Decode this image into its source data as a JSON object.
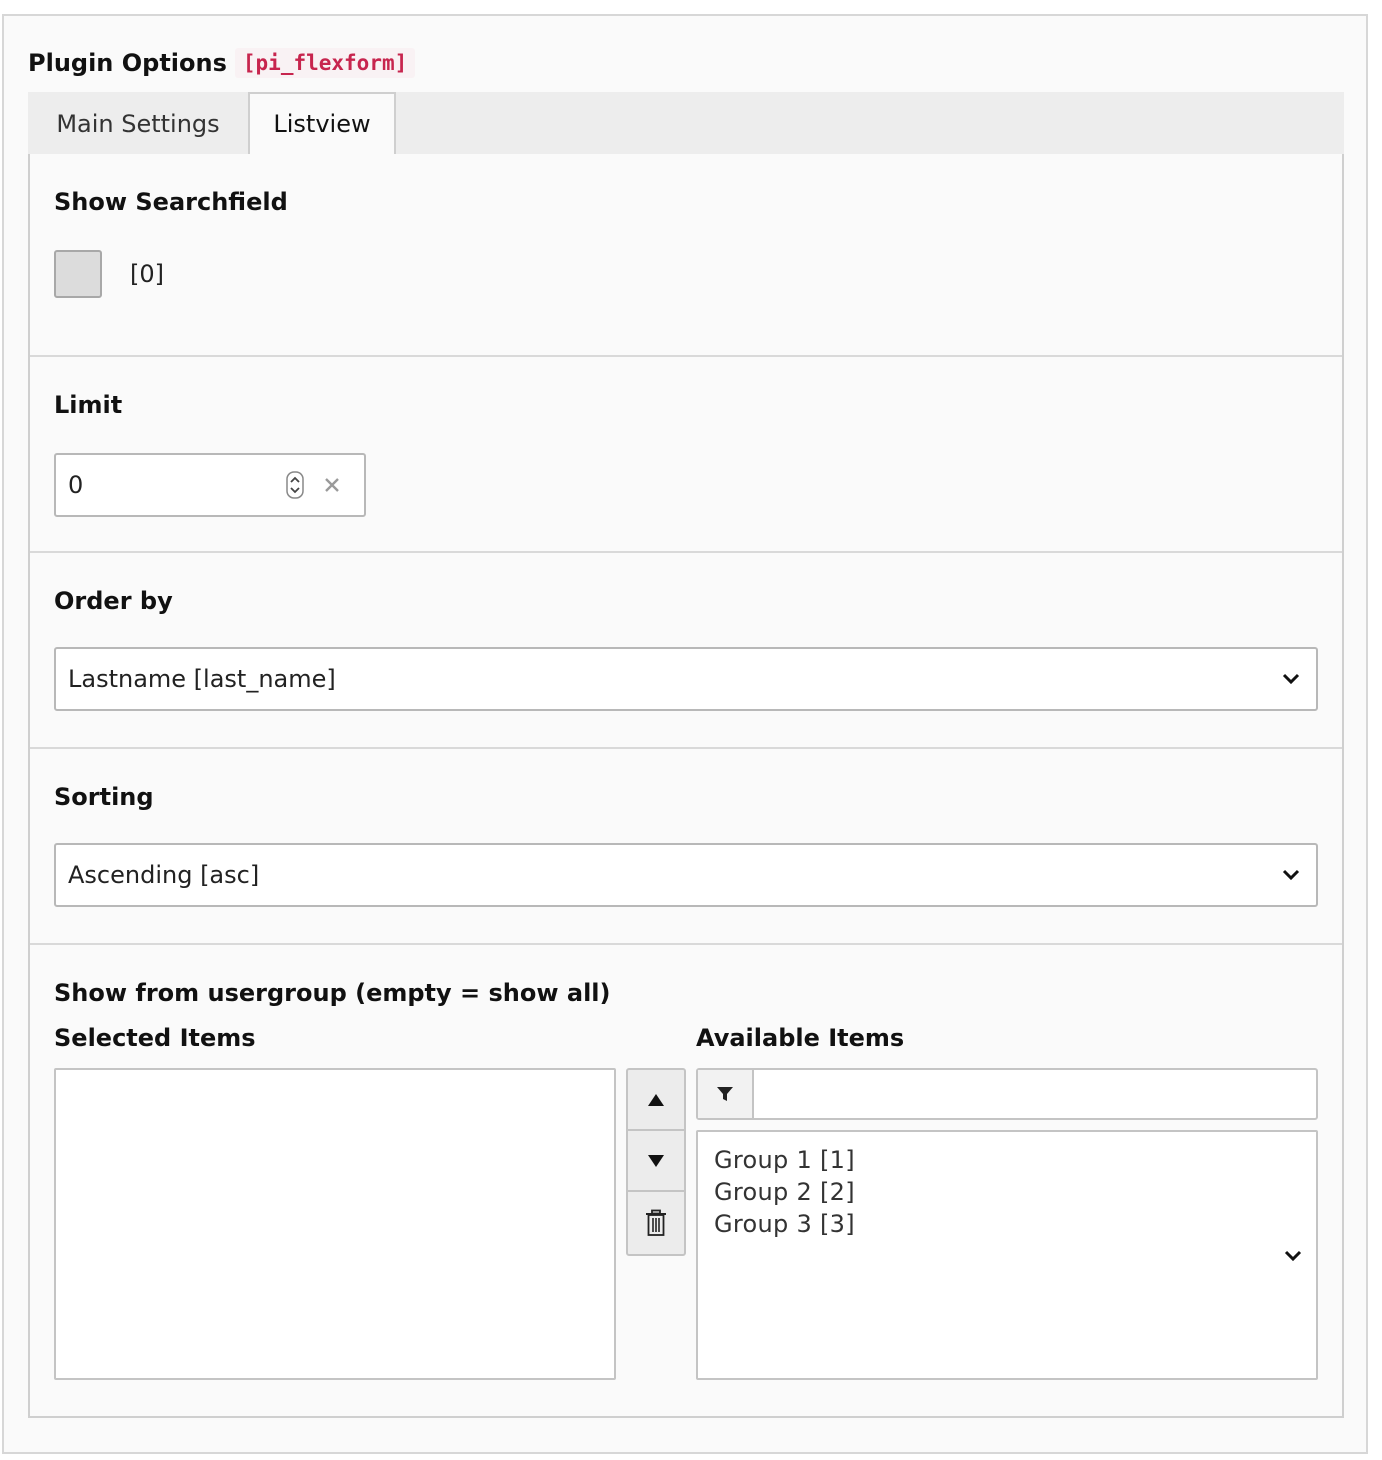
{
  "header": {
    "title": "Plugin Options",
    "code": "[pi_flexform]"
  },
  "tabs": [
    {
      "label": "Main Settings",
      "active": false
    },
    {
      "label": "Listview",
      "active": true
    }
  ],
  "show_searchfield": {
    "label": "Show Searchfield",
    "checked": false,
    "value_text": "[0]"
  },
  "limit": {
    "label": "Limit",
    "value": "0"
  },
  "order_by": {
    "label": "Order by",
    "selected": "Lastname [last_name]"
  },
  "sorting": {
    "label": "Sorting",
    "selected": "Ascending [asc]"
  },
  "usergroup": {
    "label": "Show from usergroup (empty = show all)",
    "selected_label": "Selected Items",
    "available_label": "Available Items",
    "selected_items": [],
    "filter_value": "",
    "available_items": [
      "Group 1 [1]",
      "Group 2 [2]",
      "Group 3 [3]"
    ]
  },
  "icons": {
    "spinner": "number-spinner-icon",
    "clear": "clear-x-icon",
    "select_chevron": "chevron-down-icon",
    "move_up": "triangle-up-icon",
    "move_down": "triangle-down-icon",
    "remove": "trash-icon",
    "filter": "filter-funnel-icon"
  },
  "colors": {
    "code_text": "#c7254e",
    "code_bg": "#f9f2f4",
    "panel_bg": "#fafafa",
    "tab_bg": "#ededed"
  }
}
